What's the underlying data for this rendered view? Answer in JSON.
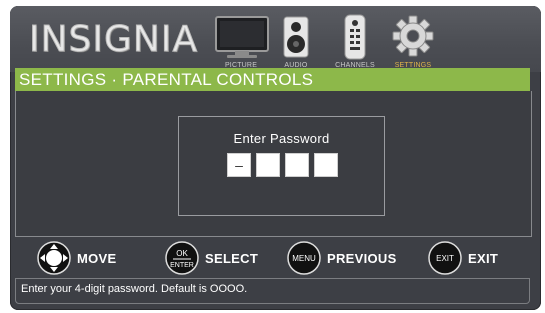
{
  "brand": "INSIGNIA",
  "menu": [
    {
      "label": "PICTURE",
      "icon": "tv-icon",
      "active": false
    },
    {
      "label": "AUDIO",
      "icon": "speaker-icon",
      "active": false
    },
    {
      "label": "CHANNELS",
      "icon": "remote-icon",
      "active": false
    },
    {
      "label": "SETTINGS",
      "icon": "gear-icon",
      "active": true
    }
  ],
  "screen_title": "SETTINGS · PARENTAL CONTROLS",
  "dialog": {
    "title": "Enter Password",
    "digits": [
      "–",
      "",
      "",
      ""
    ]
  },
  "help": [
    {
      "key": "",
      "label": "MOVE",
      "icon": "dpad-icon"
    },
    {
      "key": "OK ENTER",
      "label": "SELECT",
      "icon": "ok-enter-icon"
    },
    {
      "key": "MENU",
      "label": "PREVIOUS",
      "icon": "menu-button-icon"
    },
    {
      "key": "EXIT",
      "label": "EXIT",
      "icon": "exit-button-icon"
    }
  ],
  "status_text": "Enter your 4-digit password. Default is OOOO.",
  "colors": {
    "frame": "#3d3f45",
    "title_bar": "#8db84a",
    "active_menu": "#e0b34a"
  }
}
